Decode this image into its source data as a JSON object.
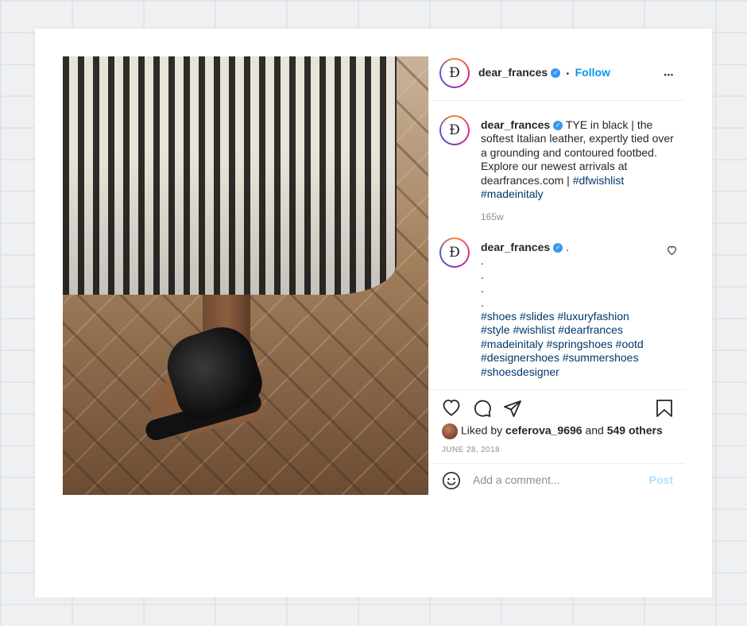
{
  "post": {
    "username": "dear_frances",
    "follow_label": "Follow",
    "separator": "•",
    "more_label": "•••",
    "avatar_glyph": "Ð"
  },
  "caption": {
    "username": "dear_frances",
    "text": "TYE in black | the softest Italian leather, expertly tied over a grounding and contoured footbed. Explore our newest arrivals at dearfrances.com |",
    "tags": [
      "#dfwishlist",
      "#madeinitaly"
    ],
    "age": "165w"
  },
  "comment": {
    "username": "dear_frances",
    "first_line": ".",
    "dot_lines": [
      ".",
      ".",
      ".",
      "."
    ],
    "hashtag_lines": [
      "#shoes #slides #luxuryfashion",
      "#style #wishlist #dearfrances",
      "#madeinitaly #springshoes #ootd",
      "#designershoes #summershoes",
      "#shoesdesigner"
    ]
  },
  "actions": {
    "liked_by_prefix": "Liked by",
    "liked_by_user": "ceferova_9696",
    "and_text": "and",
    "others": "549 others",
    "date": "JUNE 28, 2018"
  },
  "add_comment": {
    "placeholder": "Add a comment...",
    "post_label": "Post"
  },
  "icons": {
    "like": "heart-icon",
    "comment": "comment-icon",
    "share": "paper-plane-icon",
    "save": "bookmark-icon",
    "emoji": "smiley-icon",
    "verified": "verified-badge-icon",
    "more": "more-dots-icon"
  },
  "colors": {
    "link_blue": "#0095f6",
    "hashtag": "#00376b",
    "verified": "#3897f0",
    "muted": "#8e8e8e"
  }
}
